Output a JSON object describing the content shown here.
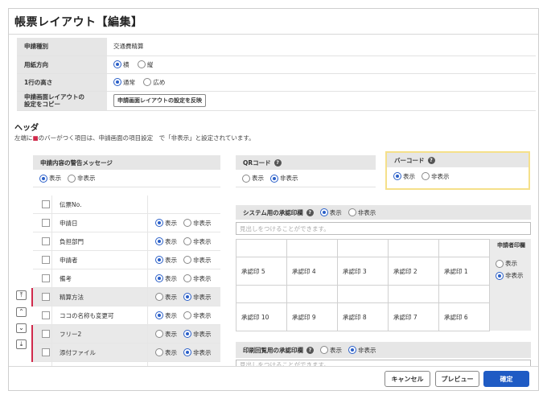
{
  "page": {
    "title": "帳票レイアウト【編集】"
  },
  "settings": {
    "type_label": "申請種別",
    "type_value": "交通費精算",
    "orientation_label": "用紙方向",
    "orientation_options": [
      "横",
      "縦"
    ],
    "orientation_selected": "横",
    "row_height_label": "1行の高さ",
    "row_height_options": [
      "通常",
      "広め"
    ],
    "row_height_selected": "通常",
    "copy_label_line1": "申請画面レイアウトの",
    "copy_label_line2": "設定をコピー",
    "copy_button": "申請画面レイアウトの設定を反映"
  },
  "header_section": {
    "title": "ヘッダ",
    "note_prefix": "左端に",
    "note_mark": "■",
    "note_suffix": "のバーがつく項目は、申請画面の項目設定　で「非表示」と設定されています。",
    "warning": {
      "label": "申請内容の警告メッセージ",
      "options": [
        "表示",
        "非表示"
      ],
      "selected": "表示"
    },
    "qr": {
      "label": "QRコード",
      "options": [
        "表示",
        "非表示"
      ],
      "selected": "非表示"
    },
    "barcode": {
      "label": "バーコード",
      "options": [
        "表示",
        "非表示"
      ],
      "selected": "表示"
    }
  },
  "help_icon": "?",
  "fields": [
    {
      "name": "伝票No.",
      "hidden_flag": false,
      "selected": null
    },
    {
      "name": "申請日",
      "hidden_flag": false,
      "selected": "表示"
    },
    {
      "name": "負担部門",
      "hidden_flag": false,
      "selected": "表示"
    },
    {
      "name": "申請者",
      "hidden_flag": false,
      "selected": "表示"
    },
    {
      "name": "備考",
      "hidden_flag": false,
      "selected": "表示"
    },
    {
      "name": "精算方法",
      "hidden_flag": true,
      "selected": "非表示"
    },
    {
      "name": "ココの名称も変更可",
      "hidden_flag": false,
      "selected": "表示"
    },
    {
      "name": "フリー2",
      "hidden_flag": true,
      "selected": "非表示"
    },
    {
      "name": "添付ファイル",
      "hidden_flag": true,
      "selected": "非表示"
    }
  ],
  "field_option_labels": [
    "表示",
    "非表示"
  ],
  "movers": [
    {
      "icon": "move-top-icon",
      "glyph": "⤒"
    },
    {
      "icon": "move-up-icon",
      "glyph": "⌃"
    },
    {
      "icon": "move-down-icon",
      "glyph": "⌄"
    },
    {
      "icon": "move-bottom-icon",
      "glyph": "⤓"
    }
  ],
  "system_stamp": {
    "label": "システム用の承認印欄",
    "options": [
      "表示",
      "非表示"
    ],
    "selected": "表示",
    "placeholder": "見出しをつけることができます。",
    "row1": [
      "承認印 5",
      "承認印 4",
      "承認印 3",
      "承認印 2",
      "承認印 1"
    ],
    "row2": [
      "承認印 10",
      "承認印 9",
      "承認印 8",
      "承認印 7",
      "承認印 6"
    ],
    "applicant_label": "申請者印欄",
    "applicant_options": [
      "表示",
      "非表示"
    ],
    "applicant_selected": "非表示"
  },
  "print_stamp": {
    "label": "印刷回覧用の承認印欄",
    "options": [
      "表示",
      "非表示"
    ],
    "selected": "非表示",
    "placeholder": "見出しをつけることができます。"
  },
  "footer": {
    "cancel": "キャンセル",
    "preview": "プレビュー",
    "confirm": "確定"
  },
  "colors": {
    "accent": "#1f5bc4",
    "hidden_bar": "#d0294b",
    "highlight": "#f5e08a"
  }
}
